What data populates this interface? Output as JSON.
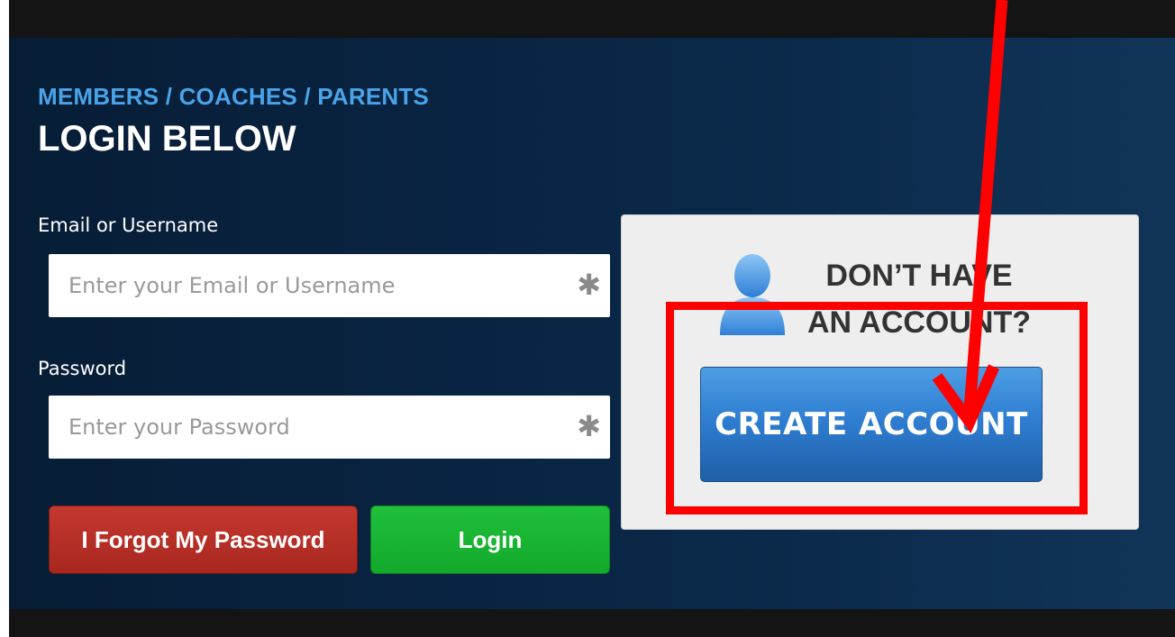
{
  "header": {
    "subtitle": "MEMBERS / COACHES / PARENTS",
    "title": "LOGIN BELOW"
  },
  "form": {
    "email_label": "Email or Username",
    "email_placeholder": "Enter your Email or Username",
    "password_label": "Password",
    "password_placeholder": "Enter your Password",
    "required_marker": "✱",
    "forgot_label": "I Forgot My Password",
    "login_label": "Login"
  },
  "signup": {
    "line1": "DON’T HAVE",
    "line2": "AN ACCOUNT?",
    "create_label": "CREATE ACCOUNT",
    "icon": "user-icon"
  },
  "annotation": {
    "color": "#ff0000"
  },
  "colors": {
    "panel_bg": "#0a2848",
    "subtitle": "#4aa3e8",
    "forgot_button": "#b12e26",
    "login_button": "#17b332",
    "create_button": "#2f7ed2"
  }
}
